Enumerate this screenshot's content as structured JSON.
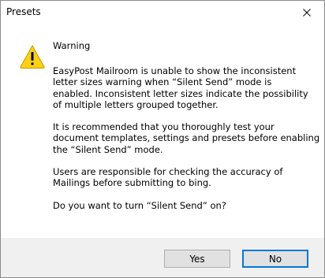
{
  "dialog": {
    "title": "Presets",
    "icon": "warning-icon",
    "heading": "Warning",
    "lines": {
      "p1": [
        "EasyPost Mailroom is unable to show the inconsistent",
        "letter sizes warning when “Silent Send” mode is",
        "enabled. Inconsistent letter sizes indicate the possibility",
        "of multiple letters grouped together."
      ],
      "p2": [
        "It is recommended that you thoroughly test your",
        "document templates, settings and presets before enabling",
        "the “Silent Send” mode."
      ],
      "p3": [
        "Users are responsible for checking the accuracy of",
        "Mailings before submitting to bing."
      ],
      "p4": [
        "Do you want to turn “Silent Send” on?"
      ]
    },
    "buttons": {
      "yes": "Yes",
      "no": "No"
    },
    "colors": {
      "warning_fill": "#fcd116",
      "focus_border": "#0078d7",
      "footer_bg": "#f0f0f0"
    }
  }
}
